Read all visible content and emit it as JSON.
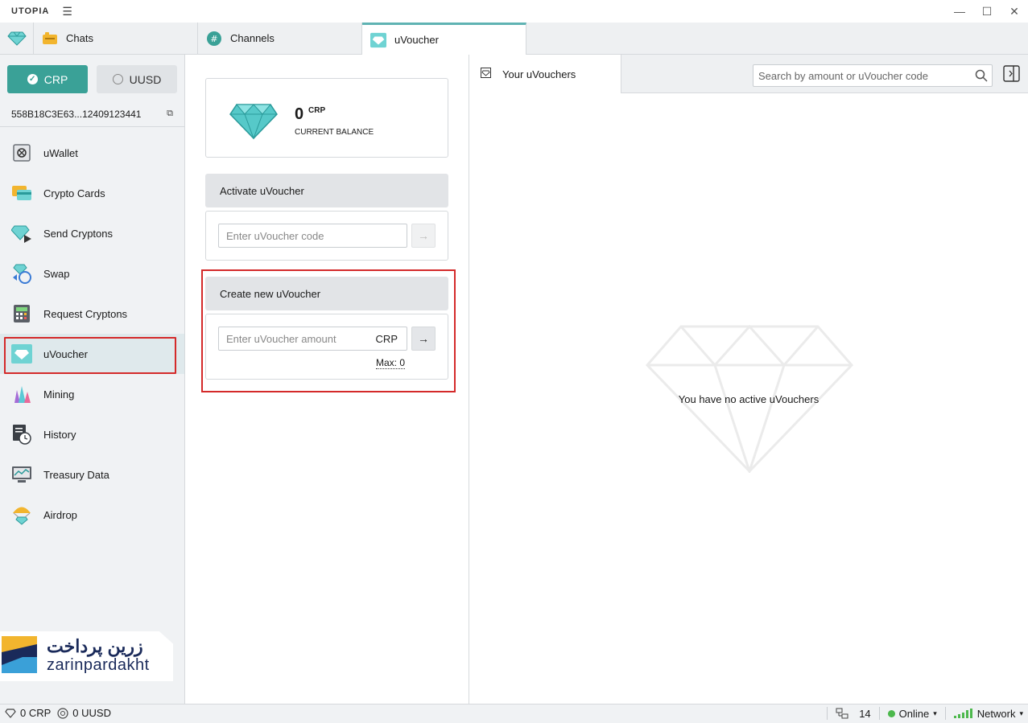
{
  "titlebar": {
    "app_name": "UTOPIA",
    "menu_icon": "hamburger-icon"
  },
  "tabs": [
    {
      "label": "Chats",
      "icon": "chats-icon"
    },
    {
      "label": "Channels",
      "icon": "channels-icon"
    },
    {
      "label": "uVoucher",
      "icon": "diamond-icon",
      "active": true
    }
  ],
  "sidebar": {
    "currency_crp": "CRP",
    "currency_uusd": "UUSD",
    "address": "558B18C3E63...12409123441",
    "items": [
      {
        "label": "uWallet",
        "icon": "safe-icon"
      },
      {
        "label": "Crypto Cards",
        "icon": "cards-icon"
      },
      {
        "label": "Send Cryptons",
        "icon": "send-diamond-icon"
      },
      {
        "label": "Swap",
        "icon": "swap-icon"
      },
      {
        "label": "Request Cryptons",
        "icon": "calculator-icon"
      },
      {
        "label": "uVoucher",
        "icon": "voucher-icon",
        "active": true
      },
      {
        "label": "Mining",
        "icon": "crystals-icon"
      },
      {
        "label": "History",
        "icon": "history-icon"
      },
      {
        "label": "Treasury Data",
        "icon": "treasury-icon"
      },
      {
        "label": "Airdrop",
        "icon": "airdrop-icon"
      }
    ],
    "watermark": {
      "fa": "زرین پرداخت",
      "en": "zarinpardakht"
    }
  },
  "balance": {
    "value": "0",
    "unit": "CRP",
    "label": "CURRENT BALANCE"
  },
  "activate": {
    "title": "Activate uVoucher",
    "placeholder": "Enter uVoucher code"
  },
  "create": {
    "title": "Create new uVoucher",
    "placeholder": "Enter uVoucher amount",
    "unit": "CRP",
    "max_label": "Max: 0"
  },
  "right_panel": {
    "tab_label": "Your uVouchers",
    "search_placeholder": "Search by amount or uVoucher code",
    "empty_text": "You have no active uVouchers"
  },
  "statusbar": {
    "crp": "0 CRP",
    "uusd": "0 UUSD",
    "peers": "14",
    "status": "Online",
    "network": "Network"
  },
  "colors": {
    "accent": "#3aa197",
    "highlight": "#d42a2a",
    "online": "#4cb84c"
  }
}
